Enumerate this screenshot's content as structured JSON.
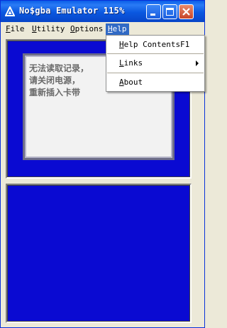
{
  "window": {
    "title": "No$gba Emulator 115%"
  },
  "menubar": {
    "items": [
      {
        "key": "F",
        "rest": "ile"
      },
      {
        "key": "U",
        "rest": "tility"
      },
      {
        "key": "O",
        "rest": "ptions"
      },
      {
        "key": "H",
        "rest": "elp"
      }
    ]
  },
  "help_menu": {
    "contents": {
      "key": "H",
      "rest": "elp Contents",
      "accel": "F1"
    },
    "links": {
      "key": "L",
      "rest": "inks"
    },
    "about": {
      "key": "A",
      "rest": "bout"
    }
  },
  "screen_message": {
    "line1": "无法读取记录，",
    "line2": "请关闭电源，",
    "line3": "重新插入卡带"
  },
  "colors": {
    "screen_blue": "#0a0ad2",
    "title_blue": "#0a58e0",
    "menu_highlight": "#316ac5"
  }
}
